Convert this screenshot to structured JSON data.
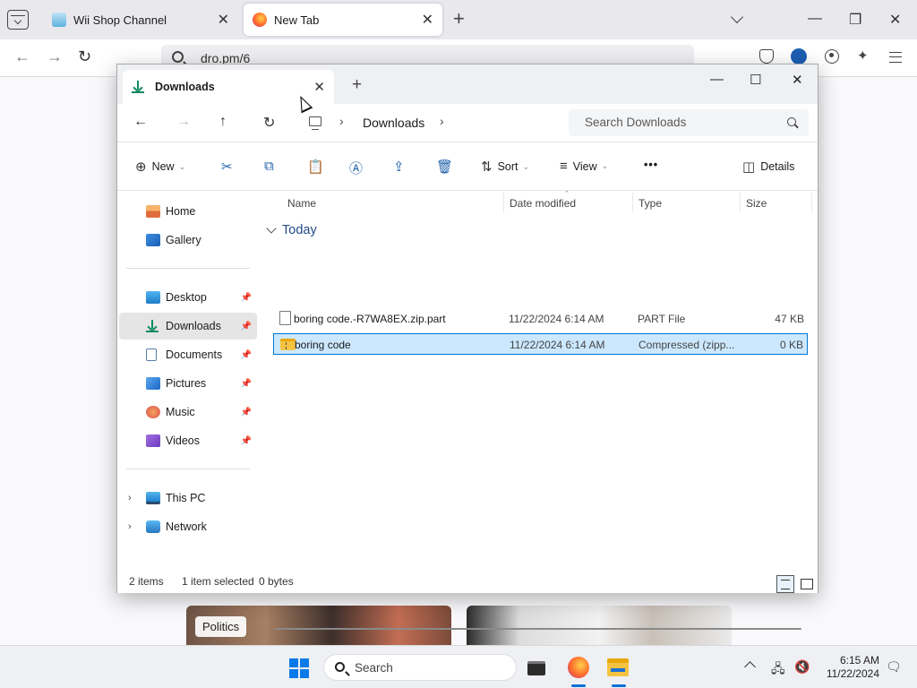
{
  "browser": {
    "tabs": [
      {
        "title": "Wii Shop Channel",
        "close": "✕"
      },
      {
        "title": "New Tab",
        "close": "✕"
      }
    ],
    "new_tab": "+",
    "window_controls": {
      "minimize": "—",
      "restore": "❐",
      "close": "✕"
    },
    "nav": {
      "back": "←",
      "forward": "→",
      "reload": "↻"
    },
    "url": "dro.pm/6",
    "extensions_icon": "✦",
    "news_tag": "Politics"
  },
  "explorer": {
    "tab_title": "Downloads",
    "tab_close": "✕",
    "new_tab": "+",
    "window_controls": {
      "minimize": "—",
      "maximize": "☐",
      "close": "✕"
    },
    "nav": {
      "back": "←",
      "forward": "→",
      "up": "↑",
      "refresh": "↻"
    },
    "breadcrumb": {
      "sep1": "›",
      "current": "Downloads",
      "sep2": "›"
    },
    "search_placeholder": "Search Downloads",
    "commands": {
      "new": "New",
      "new_icon": "⊕",
      "cut_icon": "✂",
      "copy_icon": "⧉",
      "paste_icon": "📋",
      "rename_icon": "Ⓐ",
      "share_icon": "⇪",
      "delete_icon": "🗑",
      "sort": "Sort",
      "sort_icon": "⇅",
      "view": "View",
      "view_icon": "≡",
      "more": "•••",
      "details": "Details",
      "details_icon": "◫",
      "chevron": "⌄"
    },
    "nav_pane": {
      "home": "Home",
      "gallery": "Gallery",
      "desktop": "Desktop",
      "downloads": "Downloads",
      "documents": "Documents",
      "pictures": "Pictures",
      "music": "Music",
      "videos": "Videos",
      "this_pc": "This PC",
      "network": "Network",
      "pin": "📌",
      "expand": "›"
    },
    "columns": {
      "name": "Name",
      "date": "Date modified",
      "type": "Type",
      "size": "Size",
      "sort_caret": "⌃"
    },
    "group": "Today",
    "files": [
      {
        "name": "boring code.-R7WA8EX.zip.part",
        "date": "11/22/2024 6:14 AM",
        "type": "PART File",
        "size": "47 KB"
      },
      {
        "name": "boring code",
        "date": "11/22/2024 6:14 AM",
        "type": "Compressed (zipp...",
        "size": "0 KB"
      }
    ],
    "status": {
      "items": "2 items",
      "selected": "1 item selected",
      "bytes": "0 bytes"
    }
  },
  "taskbar": {
    "search": "Search",
    "time": "6:15 AM",
    "date": "11/22/2024",
    "tray": {
      "network": "🖧",
      "volume": "🔇",
      "notifications": "🗨"
    }
  },
  "colors": {
    "accent": "#0078d4",
    "selection": "#cce8ff",
    "downloads_green": "#0f8a5f"
  }
}
